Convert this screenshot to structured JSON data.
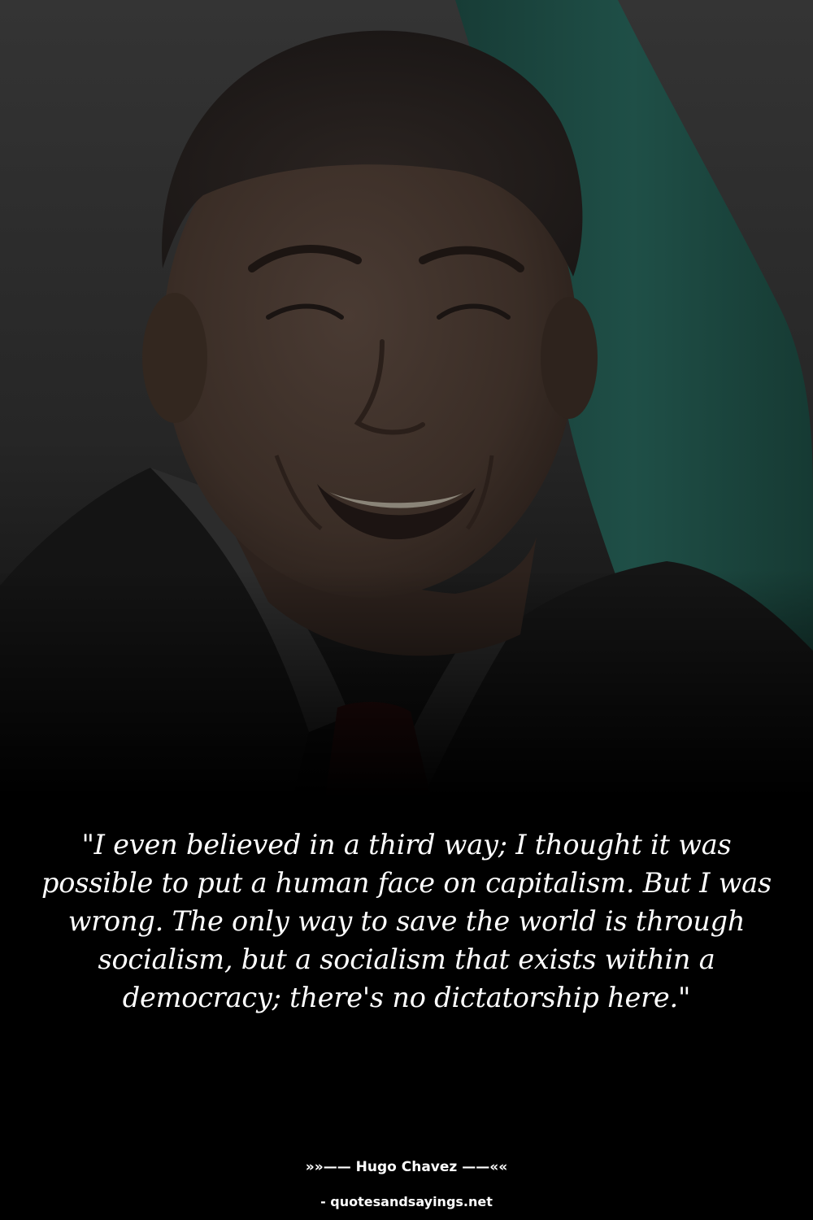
{
  "quote": {
    "text": "\"I even believed in a third way; I thought it was possible to put a human face on capitalism. But I was wrong. The only way to save the world is through socialism, but a socialism that exists within a democracy; there's no dictatorship here.\""
  },
  "author": {
    "label": "»»—— Hugo Chavez ——««"
  },
  "credit": {
    "label": "- quotesandsayings.net"
  },
  "colors": {
    "background": "#000000",
    "text": "#ffffff",
    "flag_teal": "#1f4f47",
    "backdrop": "#303030"
  }
}
